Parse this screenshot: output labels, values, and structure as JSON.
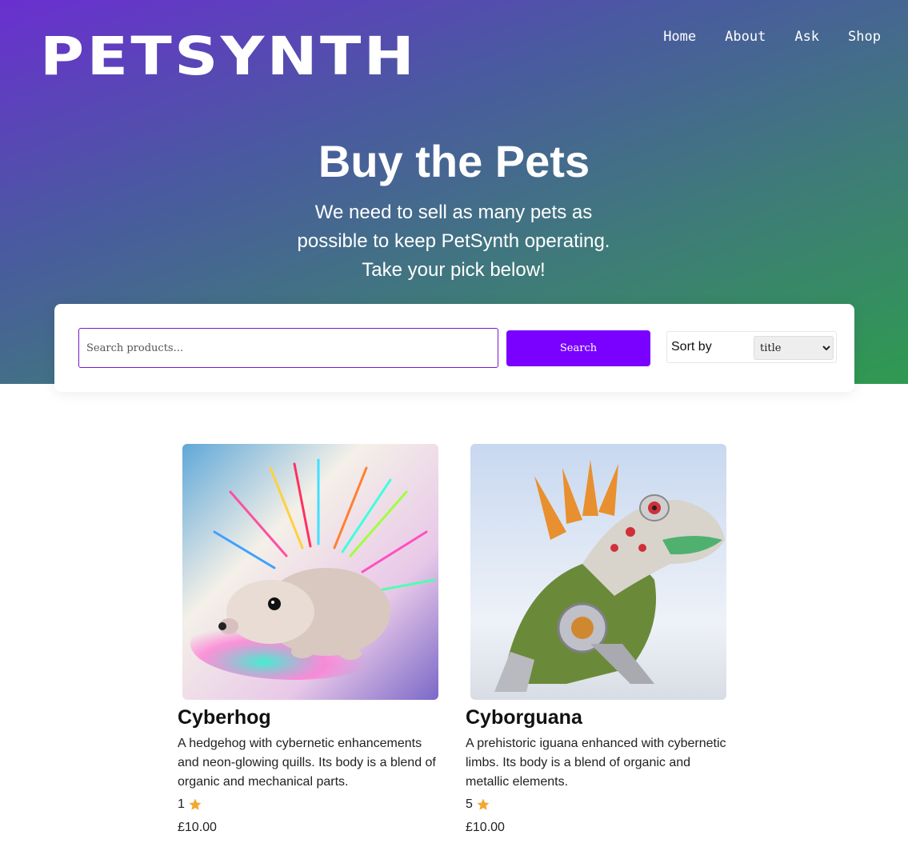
{
  "brand": {
    "logo": "PETSYNTH"
  },
  "nav": {
    "items": [
      "Home",
      "About",
      "Ask",
      "Shop"
    ]
  },
  "hero": {
    "title": "Buy the Pets",
    "subtitle": "We need to sell as many pets as possible to keep PetSynth operating. Take your pick below!"
  },
  "toolbar": {
    "search_placeholder": "Search products...",
    "search_value": "",
    "search_button": "Search",
    "sort_label": "Sort by",
    "sort_value": "title"
  },
  "products": [
    {
      "title": "Cyberhog",
      "description": "A hedgehog with cybernetic enhancements and neon-glowing quills. Its body is a blend of organic and mechanical parts.",
      "rating": "1",
      "price": "£10.00",
      "image_icon": "hedgehog-image"
    },
    {
      "title": "Cyborguana",
      "description": "A prehistoric iguana enhanced with cybernetic limbs. Its body is a blend of organic and metallic elements.",
      "rating": "5",
      "price": "£10.00",
      "image_icon": "iguana-image"
    }
  ],
  "colors": {
    "accent": "#7a00ff",
    "star": "#f0a830",
    "hero_start": "#6a2fd0",
    "hero_end": "#2f9a50"
  }
}
